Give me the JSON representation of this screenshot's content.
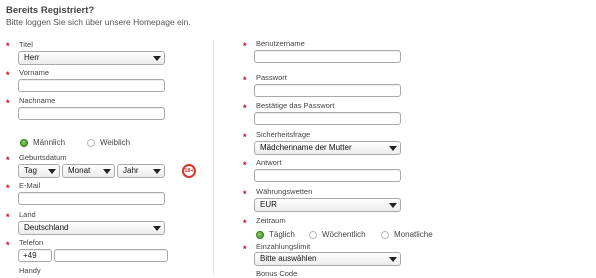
{
  "header": {
    "title": "Bereits Registriert?",
    "subtitle": "Bitte loggen Sie sich über unsere Homepage ein."
  },
  "left": {
    "titel_label": "Titel",
    "titel_value": "Herr",
    "vorname_label": "Vorname",
    "vorname_value": "",
    "nachname_label": "Nachname",
    "nachname_value": "",
    "gender_male_label": "Männlich",
    "gender_female_label": "Weiblich",
    "geburtsdatum_label": "Geburtsdatum",
    "tag_value": "Tag",
    "monat_value": "Monat",
    "jahr_value": "Jahr",
    "age_badge": "18+",
    "email_label": "E-Mail",
    "email_value": "",
    "land_label": "Land",
    "land_value": "Deutschland",
    "telefon_label": "Telefon",
    "telefon_prefix": "+49",
    "telefon_value": "",
    "handy_label": "Handy"
  },
  "right": {
    "benutzername_label": "Benutzername",
    "passwort_label": "Passwort",
    "passwort_bestaetigen_label": "Bestätige das Passwort",
    "sicherheitsfrage_label": "Sicherheitsfrage",
    "sicherheitsfrage_value": "Mädchenname der Mutter",
    "antwort_label": "Antwort",
    "waehrung_label": "Währungswetten",
    "waehrung_value": "EUR",
    "zeitraum_label": "Zeitraum",
    "zeitraum_daily": "Täglich",
    "zeitraum_weekly": "Wöchentlich",
    "zeitraum_monthly": "Monatliche",
    "einzahlungslimit_label": "Einzahlungslimit",
    "einzahlungslimit_value": "Bitte auswählen",
    "bonus_code_label": "Bonus Code"
  },
  "colors": {
    "required_star": "#d0021b",
    "radio_selected": "#3c8f1d",
    "age_badge": "#d8342b"
  },
  "icons": [
    "chevron-down-icon",
    "required-star-icon",
    "age-18-plus-icon"
  ]
}
